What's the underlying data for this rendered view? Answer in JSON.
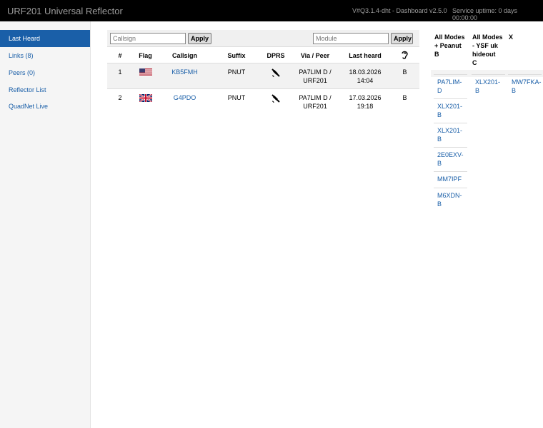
{
  "header": {
    "title": "URF201 Universal Reflector",
    "version": "V#Q3.1.4-dht - Dashboard v2.5.0",
    "uptime": "Service uptime: 0 days 00:00:00"
  },
  "sidebar": {
    "items": [
      {
        "label": "Last Heard"
      },
      {
        "label": "Links (8)"
      },
      {
        "label": "Peers (0)"
      },
      {
        "label": "Reflector List"
      },
      {
        "label": "QuadNet Live"
      }
    ]
  },
  "filters": {
    "callsign_placeholder": "Callsign",
    "module_placeholder": "Module",
    "apply_label": "Apply"
  },
  "table": {
    "headers": [
      "#",
      "Flag",
      "Callsign",
      "Suffix",
      "DPRS",
      "Via / Peer",
      "Last heard",
      "ear-icon"
    ],
    "rows": [
      {
        "num": "1",
        "flag": "us",
        "callsign": "KB5FMH",
        "suffix": "PNUT",
        "via_line1": "PA7LIM D /",
        "via_line2": "URF201",
        "date": "18.03.2026",
        "time": "14:04",
        "module": "B"
      },
      {
        "num": "2",
        "flag": "gb",
        "callsign": "G4PDO",
        "suffix": "PNUT",
        "via_line1": "PA7LIM D /",
        "via_line2": "URF201",
        "date": "17.03.2026",
        "time": "19:18",
        "module": "B"
      }
    ]
  },
  "modes": {
    "columns": [
      {
        "line1": "All Modes",
        "line2": "+ Peanut",
        "line3": "B",
        "entries": [
          [
            "PA7LIM-",
            "D"
          ],
          [
            "XLX201-",
            "B"
          ],
          [
            "XLX201-",
            "B"
          ],
          [
            "2E0EXV-",
            "B"
          ],
          [
            "MM7IPF",
            ""
          ],
          [
            "M6XDN-",
            "B"
          ]
        ]
      },
      {
        "line1": "All Modes",
        "line2": "- YSF uk",
        "line3": "hideout",
        "line4": "C",
        "entries": [
          [
            "XLX201-",
            "B"
          ]
        ]
      },
      {
        "line1": "X",
        "entries": [
          [
            "MW7FKA-",
            "B"
          ]
        ]
      }
    ]
  },
  "colors": {
    "accent": "#1a5fa8",
    "topbar": "#000000"
  }
}
